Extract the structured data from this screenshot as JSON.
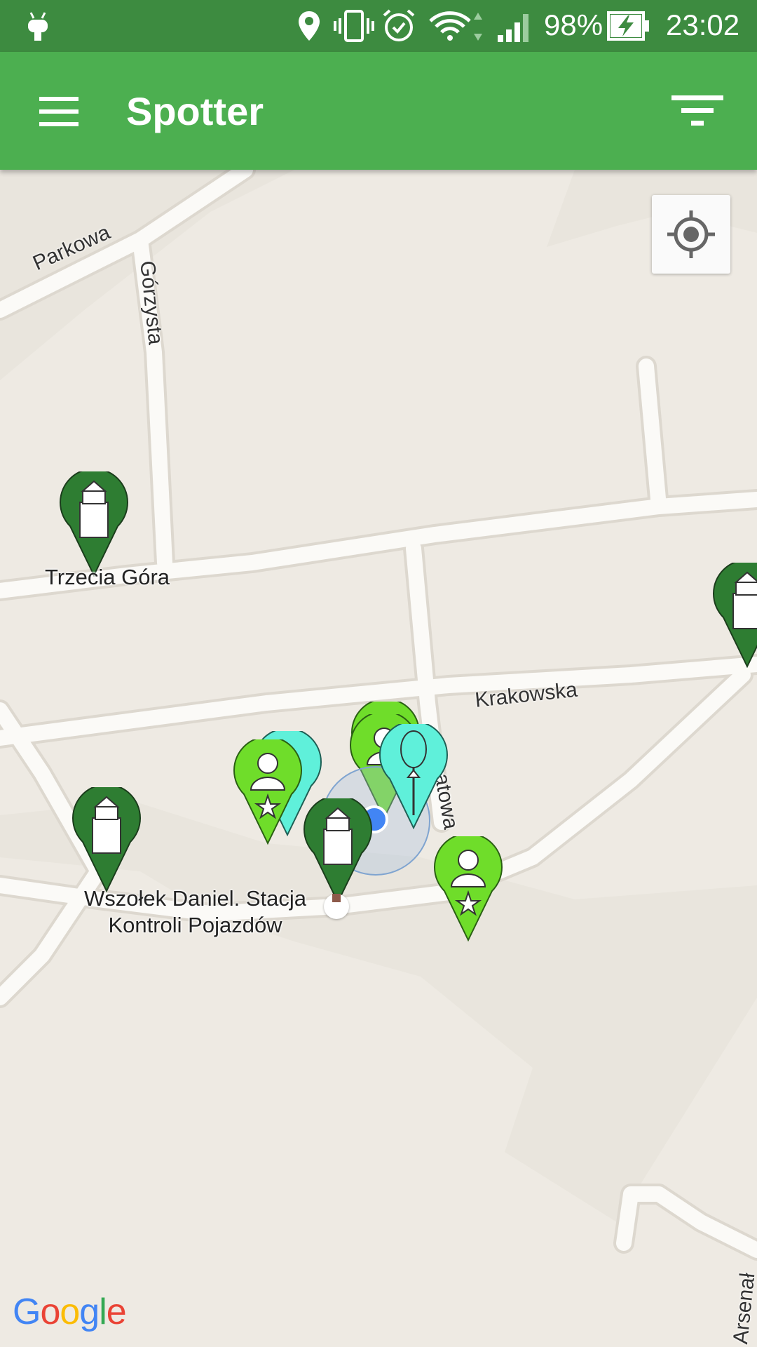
{
  "status_bar": {
    "battery": "98%",
    "time": "23:02",
    "icons": [
      "android-icon",
      "location-icon",
      "vibrate-icon",
      "alarm-icon",
      "wifi-icon",
      "signal-icon",
      "battery-charging-icon"
    ]
  },
  "app_bar": {
    "title": "Spotter",
    "menu_icon": "hamburger-menu-icon",
    "filter_icon": "filter-icon"
  },
  "map": {
    "streets": {
      "parkowa": "Parkowa",
      "gorzysta": "Górzysta",
      "krakowska": "Krakowska",
      "swiatowa": "atowa",
      "arsenal": "Arsenał"
    },
    "places": {
      "trzecia_gora": "Trzecia Góra",
      "wszolek_line1": "Wszołek Daniel. Stacja",
      "wszolek_line2": "Kontroli Pojazdów"
    },
    "attribution": "Google",
    "colors": {
      "app_bar": "#4caf50",
      "status_bar": "#3d8b40",
      "pin_dark": "#2e7d32",
      "pin_light": "#6fdd2a",
      "pin_cyan": "#5ff0da",
      "my_location": "#4285f4"
    }
  }
}
